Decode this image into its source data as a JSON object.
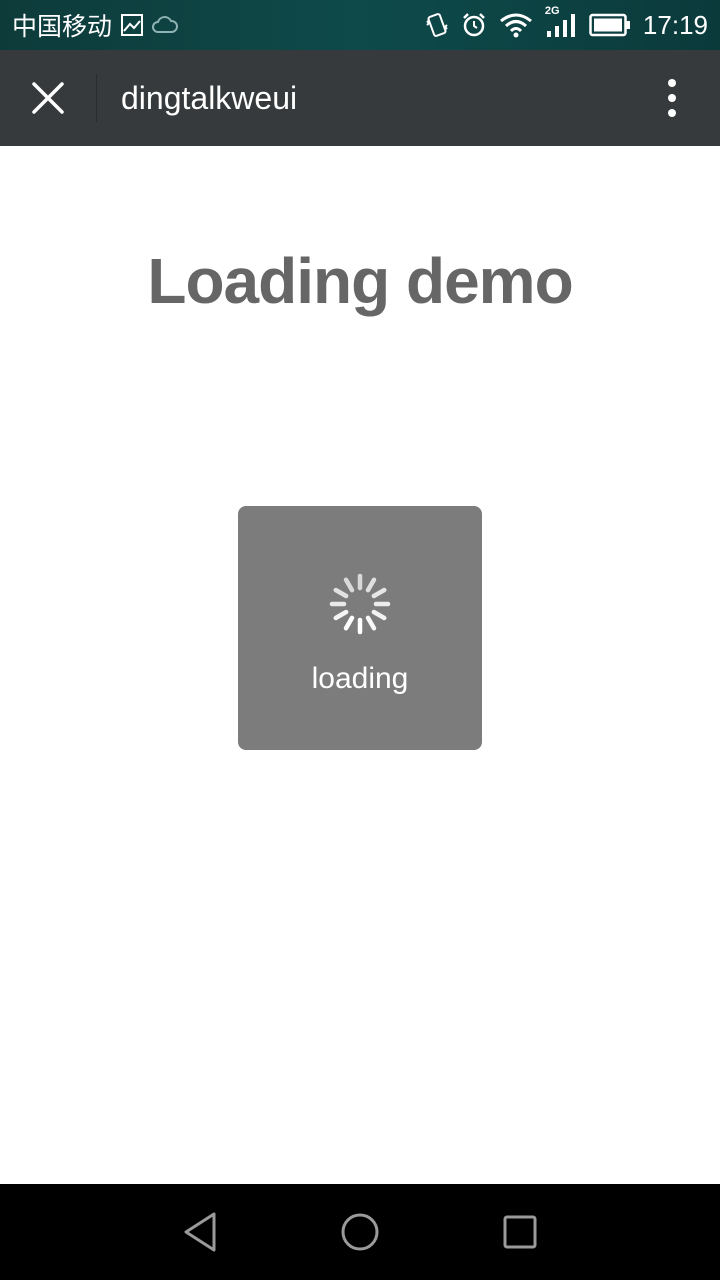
{
  "status_bar": {
    "carrier": "中国移动",
    "network": "2G",
    "time": "17:19",
    "icons": [
      "image-icon",
      "cloud-icon",
      "vibrate-icon",
      "alarm-icon",
      "wifi-icon",
      "signal-icon",
      "battery-icon"
    ]
  },
  "app_bar": {
    "title": "dingtalkweui",
    "close_icon": "close-icon",
    "menu_icon": "more-vert-icon"
  },
  "page": {
    "title": "Loading demo"
  },
  "toast": {
    "text": "loading",
    "icon": "spinner-icon"
  },
  "nav_bar": {
    "icons": [
      "back-icon",
      "home-icon",
      "recents-icon"
    ]
  },
  "colors": {
    "status_bar": "#0e4a4a",
    "app_bar": "#373a3c",
    "title_text": "#666666",
    "toast_bg": "#7a7a7a",
    "nav_bar": "#000000"
  }
}
